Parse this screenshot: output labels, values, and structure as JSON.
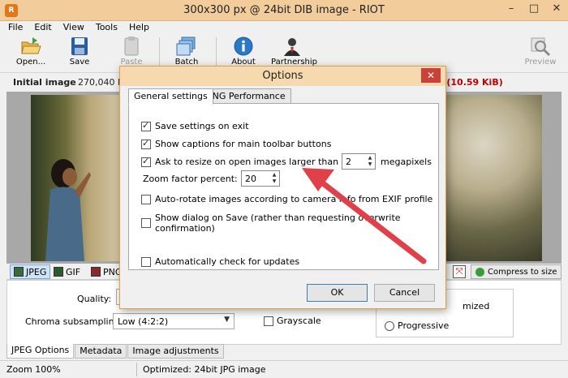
{
  "window": {
    "title": "300x300 px @ 24bit  DIB image - RIOT",
    "app_icon_text": "R",
    "controls": [
      "–",
      "□",
      "✕"
    ]
  },
  "menu": [
    "File",
    "Edit",
    "View",
    "Tools",
    "Help"
  ],
  "toolbar": {
    "open": "Open...",
    "save": "Save",
    "paste": "Paste",
    "batch": "Batch",
    "about": "About",
    "partnership": "Partnership",
    "preview": "Preview"
  },
  "info": {
    "label": "Initial image",
    "value": "270,040 b",
    "size_suffix": "s (10.59 KiB)"
  },
  "formats": {
    "jpeg": "JPEG",
    "gif": "GIF",
    "png": "PNG",
    "compress": "Compress to size"
  },
  "settings": {
    "quality_label": "Quality:",
    "chroma_label": "Chroma subsampling:",
    "chroma_value": "Low (4:2:2)",
    "grayscale": "Grayscale",
    "optimized": "mized",
    "progressive": "Progressive"
  },
  "bottom_tabs": [
    "JPEG Options",
    "Metadata",
    "Image adjustments"
  ],
  "status": {
    "zoom": "Zoom 100%",
    "message": "Optimized: 24bit JPG image"
  },
  "dialog": {
    "title": "Options",
    "close": "✕",
    "tabs": [
      "General settings",
      "PNG Performance"
    ],
    "options": {
      "save_on_exit": "Save settings on exit",
      "show_captions": "Show captions for main toolbar buttons",
      "ask_resize": "Ask to resize on open images larger than",
      "megapixels_value": "2",
      "megapixels_unit": "megapixels",
      "zoom_label": "Zoom factor percent:",
      "zoom_value": "20",
      "auto_rotate": "Auto-rotate images according to camera info from EXIF profile",
      "show_dialog_save": "Show dialog on Save (rather than requesting overwrite confirmation)",
      "auto_update": "Automatically check for updates"
    },
    "ok": "OK",
    "cancel": "Cancel"
  },
  "colors": {
    "title_bar": "#f2cc9b",
    "dialog_border": "#e2a040",
    "close_button": "#c9413a",
    "size_text": "#c00000",
    "arrow": "#e0404a"
  }
}
